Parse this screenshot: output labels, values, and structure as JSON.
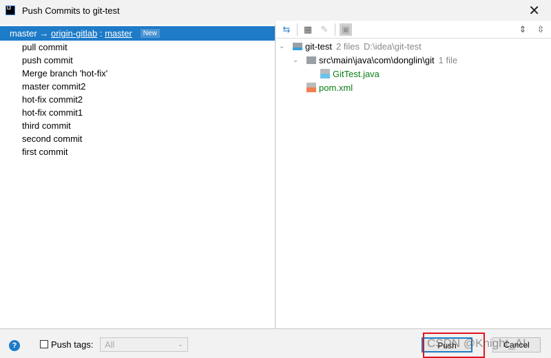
{
  "window": {
    "title": "Push Commits to git-test",
    "close_icon": "close-icon"
  },
  "branch": {
    "local": "master",
    "arrow": "→",
    "remote": "origin-gitlab",
    "separator": ":",
    "remote_branch": "master",
    "badge": "New"
  },
  "commits": [
    "pull commit",
    "push commit",
    "Merge branch 'hot-fix'",
    "master commit2",
    "hot-fix commit2",
    "hot-fix commit1",
    "third commit",
    "second commit",
    "first commit"
  ],
  "tree": {
    "root": {
      "name": "git-test",
      "count": "2 files",
      "path": "D:\\idea\\git-test"
    },
    "folder": {
      "name": "src\\main\\java\\com\\donglin\\git",
      "count": "1 file"
    },
    "files": [
      "GitTest.java",
      "pom.xml"
    ]
  },
  "footer": {
    "help": "?",
    "push_tags_label": "Push tags:",
    "tags_select": "All",
    "push_label": "Push",
    "cancel_label": "Cancel",
    "watermark": "CSDN @Knight_AL"
  },
  "colors": {
    "accent": "#1e7bc8",
    "highlight": "#e0131d",
    "file_added": "#0a7d14"
  }
}
